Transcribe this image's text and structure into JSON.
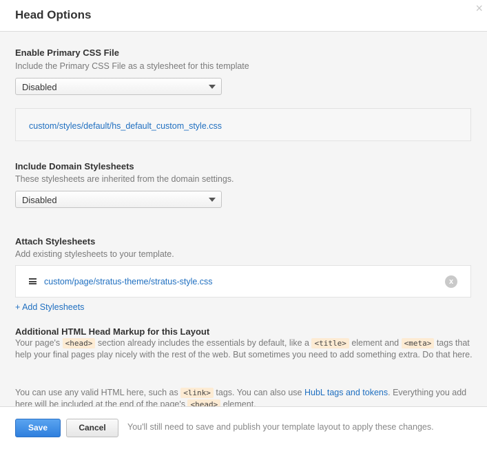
{
  "dialog": {
    "title": "Head Options",
    "close_glyph": "×"
  },
  "primary_css": {
    "title": "Enable Primary CSS File",
    "description": "Include the Primary CSS File as a stylesheet for this template",
    "select_value": "Disabled",
    "file_link": "custom/styles/default/hs_default_custom_style.css"
  },
  "domain_stylesheets": {
    "title": "Include Domain Stylesheets",
    "description": "These stylesheets are inherited from the domain settings.",
    "select_value": "Disabled"
  },
  "attach_stylesheets": {
    "title": "Attach Stylesheets",
    "description": "Add existing stylesheets to your template.",
    "items": [
      {
        "path": "custom/page/stratus-theme/stratus-style.css",
        "remove_glyph": "x"
      }
    ],
    "add_link": "+ Add Stylesheets"
  },
  "head_markup": {
    "title": "Additional HTML Head Markup for this Layout",
    "p1": {
      "t1": "Your page's ",
      "code1": "<head>",
      "t2": " section already includes the essentials by default, like a ",
      "code2": "<title>",
      "t3": " element and ",
      "code3": "<meta>",
      "t4": " tags that help your final pages play nicely with the rest of the web. But sometimes you need to add something extra. Do that here."
    },
    "p2": {
      "t1": "You can use any valid HTML here, such as ",
      "code1": "<link>",
      "t2": " tags. You can also use ",
      "link": "HubL tags and tokens",
      "t3": ". Everything you add here will be included at the end of the page's ",
      "code2": "<head>",
      "t4": " element."
    }
  },
  "footer": {
    "save_label": "Save",
    "cancel_label": "Cancel",
    "note": "You'll still need to save and publish your template layout to apply these changes."
  },
  "colors": {
    "link": "#1f6fc0",
    "primary_button": "#2f7fdd",
    "code_highlight": "#fdebd3"
  }
}
